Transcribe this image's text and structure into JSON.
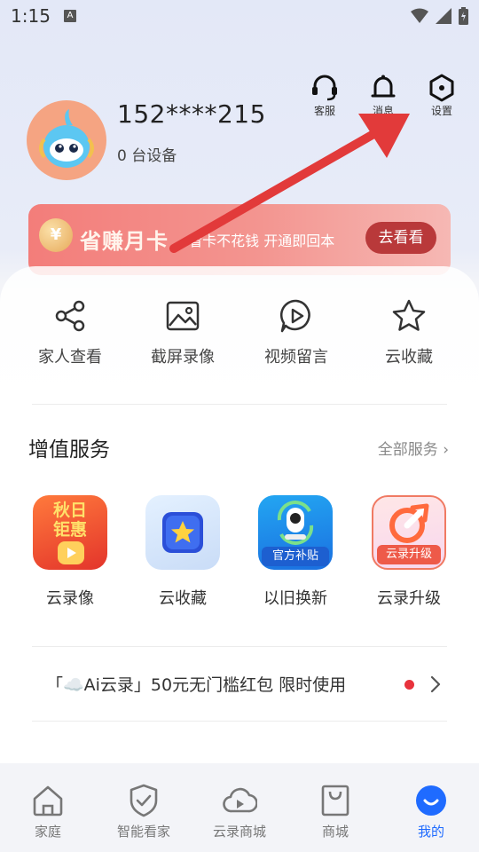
{
  "status": {
    "time": "1:15",
    "notification_letter": "A"
  },
  "header": {
    "actions": [
      {
        "label": "客服",
        "icon": "headset-icon"
      },
      {
        "label": "消息",
        "icon": "bell-icon"
      },
      {
        "label": "设置",
        "icon": "settings-hex-icon"
      }
    ],
    "username": "152****215",
    "devices": "0 台设备"
  },
  "promo": {
    "coin": "¥",
    "title": "省赚月卡",
    "subtitle": "· 看卡不花钱  开通即回本",
    "button": "去看看"
  },
  "quick_actions": [
    {
      "label": "家人查看",
      "icon": "share-icon"
    },
    {
      "label": "截屏录像",
      "icon": "image-icon"
    },
    {
      "label": "视频留言",
      "icon": "play-bubble-icon"
    },
    {
      "label": "云收藏",
      "icon": "star-icon"
    }
  ],
  "services": {
    "title": "增值服务",
    "all_label": "全部服务",
    "items": [
      {
        "label": "云录像",
        "tile_text": "秋日\n钜惠"
      },
      {
        "label": "云收藏",
        "tile_text": ""
      },
      {
        "label": "以旧换新",
        "tile_text": "官方补贴"
      },
      {
        "label": "云录升级",
        "tile_text": "云录升级"
      }
    ]
  },
  "notice": {
    "text": "「☁️Ai云录」50元无门槛红包 限时使用"
  },
  "tabbar": {
    "active_index": 4,
    "items": [
      {
        "label": "家庭",
        "icon": "house-icon"
      },
      {
        "label": "智能看家",
        "icon": "shield-check-icon"
      },
      {
        "label": "云录商城",
        "icon": "cloud-play-icon"
      },
      {
        "label": "商城",
        "icon": "shopping-bag-icon"
      },
      {
        "label": "我的",
        "icon": "smile-face-icon"
      }
    ]
  },
  "colors": {
    "accent": "#1f6bff",
    "promo_button": "#b9393a",
    "annotation_arrow": "#e23a3a",
    "notice_dot": "#e8323c"
  }
}
